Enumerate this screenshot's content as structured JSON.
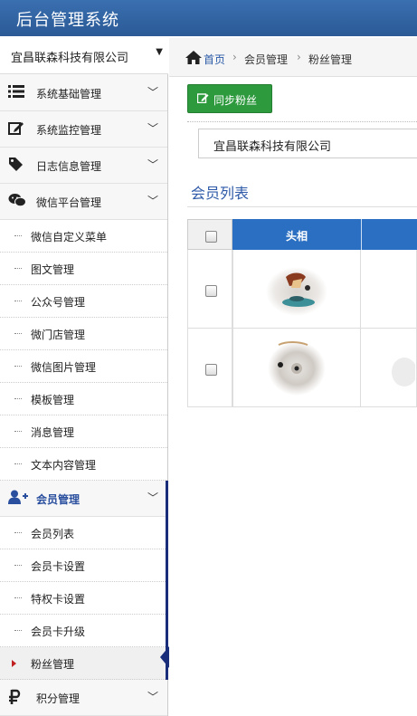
{
  "app": {
    "title": "后台管理系统"
  },
  "sidebar": {
    "company": "宜昌联森科技有限公司",
    "company_arrow": "▼",
    "chevron": "﹀",
    "groups": [
      {
        "label": "系统基础管理",
        "icon": "list-icon"
      },
      {
        "label": "系统监控管理",
        "icon": "edit-icon"
      },
      {
        "label": "日志信息管理",
        "icon": "tag-icon"
      },
      {
        "label": "微信平台管理",
        "icon": "wechat-icon"
      },
      {
        "label": "会员管理",
        "icon": "add-user-icon"
      },
      {
        "label": "积分管理",
        "icon": "ruble-icon"
      }
    ],
    "wechat_items": [
      "微信自定义菜单",
      "图文管理",
      "公众号管理",
      "微门店管理",
      "微信图片管理",
      "模板管理",
      "消息管理",
      "文本内容管理"
    ],
    "member_items": [
      "会员列表",
      "会员卡设置",
      "特权卡设置",
      "会员卡升级",
      "粉丝管理"
    ]
  },
  "breadcrumb": {
    "home": "首页",
    "section": "会员管理",
    "page": "粉丝管理",
    "separator": "›"
  },
  "toolbar": {
    "sync_label": "同步粉丝"
  },
  "filter": {
    "company_value": "宜昌联森科技有限公司"
  },
  "list": {
    "title": "会员列表",
    "headers": {
      "avatar": "头相"
    }
  },
  "colors": {
    "header": "#2b5a96",
    "accent": "#2a6fc1",
    "sync_button": "#2e9a3e",
    "active_nav": "#1a2d7a"
  }
}
